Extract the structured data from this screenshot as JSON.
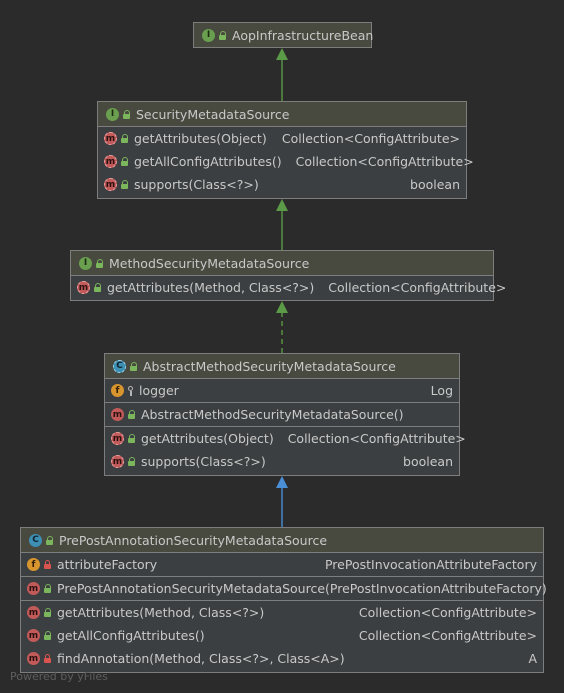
{
  "diagram": {
    "nodes": {
      "aop": {
        "title": "AopInfrastructureBean",
        "kind_icon": "interface-icon"
      },
      "sms": {
        "title": "SecurityMetadataSource",
        "kind_icon": "interface-icon",
        "methods": [
          {
            "name": "getAttributes(Object)",
            "type": "Collection<ConfigAttribute>"
          },
          {
            "name": "getAllConfigAttributes()",
            "type": "Collection<ConfigAttribute>"
          },
          {
            "name": "supports(Class<?>)",
            "type": "boolean"
          }
        ]
      },
      "msms": {
        "title": "MethodSecurityMetadataSource",
        "kind_icon": "interface-icon",
        "methods": [
          {
            "name": "getAttributes(Method, Class<?>)",
            "type": "Collection<ConfigAttribute>"
          }
        ]
      },
      "amsms": {
        "title": "AbstractMethodSecurityMetadataSource",
        "kind_icon": "abstract-class-icon",
        "fields": [
          {
            "name": "logger",
            "type": "Log"
          }
        ],
        "constructors": [
          {
            "name": "AbstractMethodSecurityMetadataSource()"
          }
        ],
        "methods": [
          {
            "name": "getAttributes(Object)",
            "type": "Collection<ConfigAttribute>"
          },
          {
            "name": "supports(Class<?>)",
            "type": "boolean"
          }
        ]
      },
      "ppasms": {
        "title": "PrePostAnnotationSecurityMetadataSource",
        "kind_icon": "class-icon",
        "fields": [
          {
            "name": "attributeFactory",
            "type": "PrePostInvocationAttributeFactory"
          }
        ],
        "constructors": [
          {
            "name": "PrePostAnnotationSecurityMetadataSource(PrePostInvocationAttributeFactory)"
          }
        ],
        "methods": [
          {
            "name": "getAttributes(Method, Class<?>)",
            "type": "Collection<ConfigAttribute>"
          },
          {
            "name": "getAllConfigAttributes()",
            "type": "Collection<ConfigAttribute>"
          },
          {
            "name": "findAnnotation(Method, Class<?>, Class<A>)",
            "type": "A"
          }
        ]
      }
    },
    "edges": [
      {
        "from": "sms",
        "to": "aop",
        "kind": "extends"
      },
      {
        "from": "msms",
        "to": "sms",
        "kind": "extends"
      },
      {
        "from": "amsms",
        "to": "msms",
        "kind": "implements"
      },
      {
        "from": "ppasms",
        "to": "amsms",
        "kind": "extends-class"
      }
    ],
    "colors": {
      "interface_arrow": "#5b9a46",
      "class_arrow": "#4a8fd6",
      "background": "#2b2b2b"
    }
  },
  "watermark": "Powered by yFiles"
}
